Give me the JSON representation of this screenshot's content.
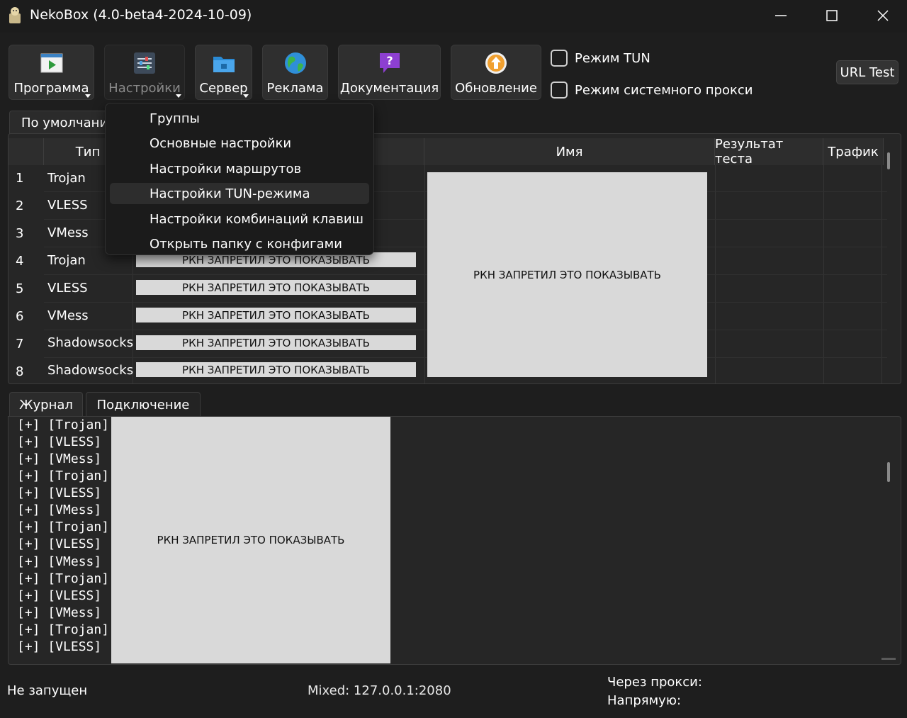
{
  "window": {
    "title": "NekoBox (4.0-beta4-2024-10-09)"
  },
  "toolbar": {
    "program": "Программа",
    "settings": "Настройки",
    "server": "Сервер",
    "ads": "Реклама",
    "docs": "Документация",
    "update": "Обновление",
    "tun_mode": "Режим TUN",
    "system_proxy_mode": "Режим системного прокси",
    "url_test": "URL Test"
  },
  "group_tab": "По умолчанию",
  "table": {
    "headers": {
      "type": "Тип",
      "name": "Имя",
      "test_result": "Результат теста",
      "traffic": "Трафик"
    },
    "rows": [
      {
        "num": "1",
        "type": "Trojan"
      },
      {
        "num": "2",
        "type": "VLESS"
      },
      {
        "num": "3",
        "type": "VMess"
      },
      {
        "num": "4",
        "type": "Trojan"
      },
      {
        "num": "5",
        "type": "VLESS"
      },
      {
        "num": "6",
        "type": "VMess"
      },
      {
        "num": "7",
        "type": "Shadowsocks"
      },
      {
        "num": "8",
        "type": "Shadowsocks"
      }
    ],
    "censor_text": "РКН ЗАПРЕТИЛ ЭТО ПОКАЗЫВАТЬ"
  },
  "menu": {
    "items": [
      "Группы",
      "Основные настройки",
      "Настройки маршрутов",
      "Настройки TUN-режима",
      "Настройки комбинаций клавиш",
      "Открыть папку с конфигами"
    ],
    "highlighted_index": 3
  },
  "log_tabs": {
    "journal": "Журнал",
    "connection": "Подключение"
  },
  "log": {
    "lines": [
      "[+] [Trojan]",
      "[+] [VLESS]",
      "[+] [VMess]",
      "[+] [Trojan]",
      "[+] [VLESS]",
      "[+] [VMess]",
      "[+] [Trojan]",
      "[+] [VLESS]",
      "[+] [VMess]",
      "[+] [Trojan]",
      "[+] [VLESS]",
      "[+] [VMess]",
      "[+] [Trojan]",
      "[+] [VLESS]"
    ],
    "censor_text": "РКН ЗАПРЕТИЛ ЭТО ПОКАЗЫВАТЬ"
  },
  "status": {
    "state": "Не запущен",
    "mixed": "Mixed: 127.0.0.1:2080",
    "via_proxy": "Через прокси:",
    "direct": "Напрямую:"
  },
  "icons": {
    "program": "play-window-icon",
    "settings": "sliders-icon",
    "server": "folder-icon",
    "ads": "globe-icon",
    "docs": "help-bubble-icon",
    "update": "update-arrow-icon"
  },
  "colors": {
    "background": "#1e1e1e",
    "censor": "#d9d9d9",
    "program_icon": "#2e9a3c",
    "server_icon": "#2a8ad4",
    "docs_icon": "#8d3fd1",
    "update_icon": "#f0a030"
  }
}
